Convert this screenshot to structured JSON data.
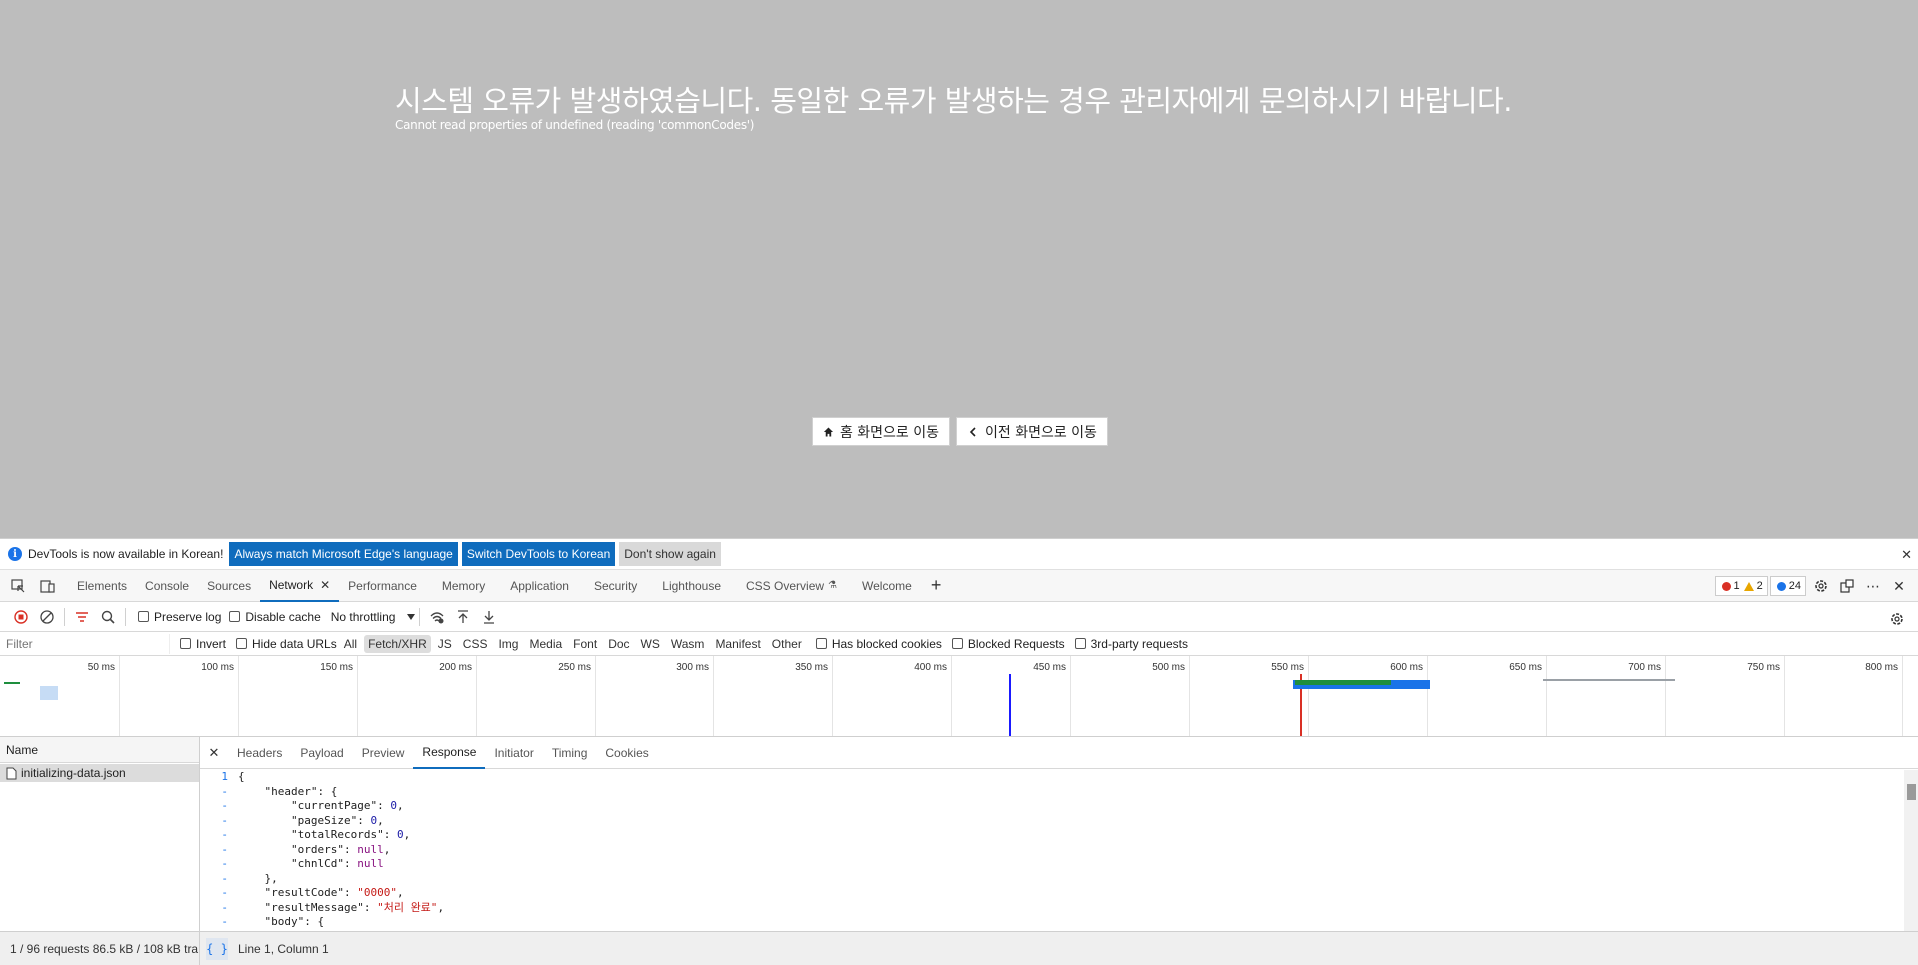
{
  "page": {
    "error_title": "시스템 오류가 발생하였습니다. 동일한 오류가 발생하는 경우 관리자에게 문의하시기 바랍니다.",
    "error_detail": "Cannot read properties of undefined (reading 'commonCodes')",
    "home_button": "홈 화면으로 이동",
    "back_button": "이전 화면으로 이동"
  },
  "infobar": {
    "message": "DevTools is now available in Korean!",
    "btn_match": "Always match Microsoft Edge's language",
    "btn_switch": "Switch DevTools to Korean",
    "btn_dismiss": "Don't show again"
  },
  "tabs": [
    "Elements",
    "Console",
    "Sources",
    "Network",
    "Performance",
    "Memory",
    "Application",
    "Security",
    "Lighthouse",
    "CSS Overview",
    "Welcome"
  ],
  "badges": {
    "errors": "1",
    "warnings": "2",
    "messages": "24"
  },
  "toolbar": {
    "preserve_log": "Preserve log",
    "disable_cache": "Disable cache",
    "throttling": "No throttling"
  },
  "filterbar": {
    "placeholder": "Filter",
    "invert": "Invert",
    "hide_data_urls": "Hide data URLs",
    "types": [
      "All",
      "Fetch/XHR",
      "JS",
      "CSS",
      "Img",
      "Media",
      "Font",
      "Doc",
      "WS",
      "Wasm",
      "Manifest",
      "Other"
    ],
    "active_type": "Fetch/XHR",
    "has_blocked_cookies": "Has blocked cookies",
    "blocked_requests": "Blocked Requests",
    "third_party": "3rd-party requests"
  },
  "timeline_ticks": [
    "50 ms",
    "100 ms",
    "150 ms",
    "200 ms",
    "250 ms",
    "300 ms",
    "350 ms",
    "400 ms",
    "450 ms",
    "500 ms",
    "550 ms",
    "600 ms",
    "650 ms",
    "700 ms",
    "750 ms",
    "800 ms"
  ],
  "requests": {
    "header": "Name",
    "items": [
      "initializing-data.json"
    ]
  },
  "detail_tabs": [
    "Headers",
    "Payload",
    "Preview",
    "Response",
    "Initiator",
    "Timing",
    "Cookies"
  ],
  "response_lines": [
    {
      "ln": "1",
      "text": "{"
    },
    {
      "ln": "-",
      "text": "    \"header\": {"
    },
    {
      "ln": "-",
      "text": "        \"currentPage\": 0,"
    },
    {
      "ln": "-",
      "text": "        \"pageSize\": 0,"
    },
    {
      "ln": "-",
      "text": "        \"totalRecords\": 0,"
    },
    {
      "ln": "-",
      "text": "        \"orders\": null,"
    },
    {
      "ln": "-",
      "text": "        \"chnlCd\": null"
    },
    {
      "ln": "-",
      "text": "    },"
    },
    {
      "ln": "-",
      "text": "    \"resultCode\": \"0000\","
    },
    {
      "ln": "-",
      "text": "    \"resultMessage\": \"처리 완료\","
    },
    {
      "ln": "-",
      "text": "    \"body\": {"
    }
  ],
  "status": {
    "requests_summary": "1 / 96 requests  86.5 kB / 108 kB tra",
    "pretty_print": "{ }",
    "cursor": "Line 1, Column 1"
  },
  "colors": {
    "accent": "#0f6cbd",
    "page_bg": "#bdbdbd",
    "error_red": "#d93025",
    "warn_yellow": "#e8a600",
    "info_blue": "#1a73e8"
  }
}
